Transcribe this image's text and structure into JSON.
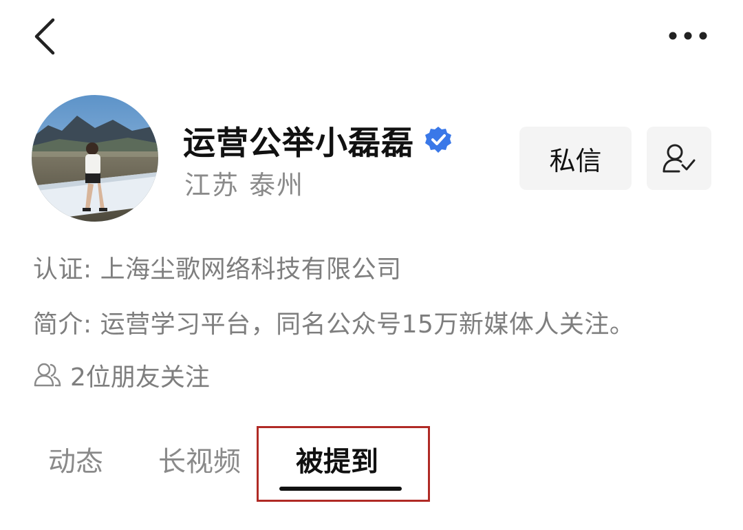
{
  "header": {
    "back_icon": "chevron-left-icon",
    "more_icon": "ellipsis-icon"
  },
  "profile": {
    "name": "运营公举小磊磊",
    "verified_icon": "verified-badge-icon",
    "verified_color": "#3a78e8",
    "location": "江苏 泰州",
    "message_button": "私信",
    "follow_icon": "user-check-icon",
    "certification": "认证: 上海尘歌网络科技有限公司",
    "intro": "简介: 运营学习平台，同名公众号15万新媒体人关注。",
    "friends_icon": "users-icon",
    "friends_following": "2位朋友关注"
  },
  "tabs": [
    {
      "label": "动态",
      "active": false
    },
    {
      "label": "长视频",
      "active": false
    },
    {
      "label": "被提到",
      "active": true
    }
  ],
  "colors": {
    "highlight_border": "#b02a25",
    "button_bg": "#f4f4f4",
    "secondary_text": "#7e7e7e"
  }
}
